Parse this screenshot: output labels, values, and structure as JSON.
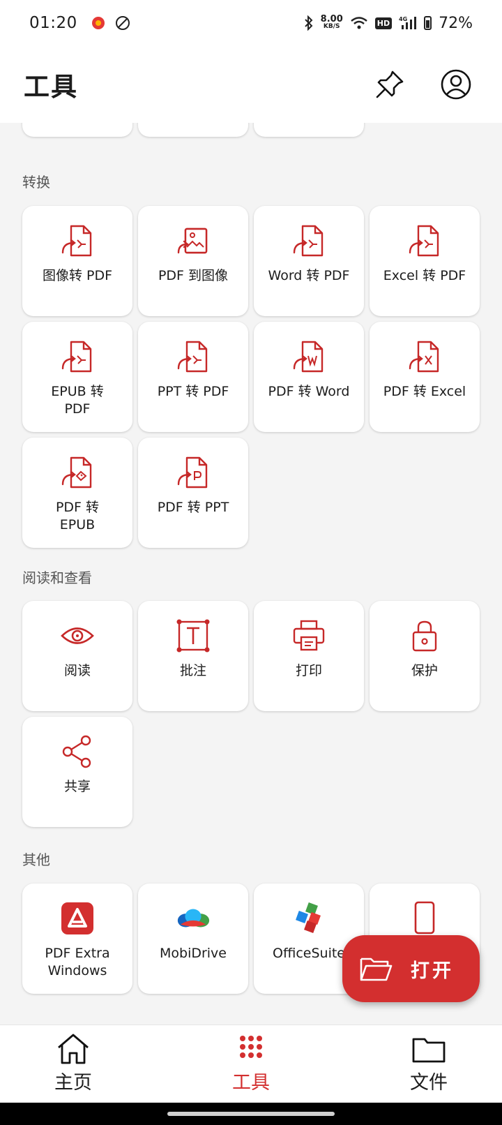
{
  "status_bar": {
    "time": "01:20",
    "net_speed_value": "8.00",
    "net_speed_unit": "KB/S",
    "hd": "HD",
    "signal": "4G",
    "battery": "72%"
  },
  "header": {
    "title": "工具"
  },
  "sections": {
    "convert": {
      "title": "转换",
      "tiles": [
        {
          "label": "图像转 PDF",
          "icon": "image-to-pdf-icon"
        },
        {
          "label": "PDF 到图像",
          "icon": "pdf-to-image-icon"
        },
        {
          "label": "Word 转 PDF",
          "icon": "word-to-pdf-icon"
        },
        {
          "label": "Excel 转 PDF",
          "icon": "excel-to-pdf-icon"
        },
        {
          "label": "EPUB 转\nPDF",
          "icon": "epub-to-pdf-icon"
        },
        {
          "label": "PPT 转 PDF",
          "icon": "ppt-to-pdf-icon"
        },
        {
          "label": "PDF 转 Word",
          "icon": "pdf-to-word-icon"
        },
        {
          "label": "PDF 转 Excel",
          "icon": "pdf-to-excel-icon"
        },
        {
          "label": "PDF 转\nEPUB",
          "icon": "pdf-to-epub-icon"
        },
        {
          "label": "PDF 转 PPT",
          "icon": "pdf-to-ppt-icon"
        }
      ]
    },
    "read": {
      "title": "阅读和查看",
      "tiles": [
        {
          "label": "阅读",
          "icon": "eye-icon"
        },
        {
          "label": "批注",
          "icon": "annotate-icon"
        },
        {
          "label": "打印",
          "icon": "printer-icon"
        },
        {
          "label": "保护",
          "icon": "lock-icon"
        },
        {
          "label": "共享",
          "icon": "share-icon"
        }
      ]
    },
    "other": {
      "title": "其他",
      "tiles": [
        {
          "label": "PDF Extra\nWindows",
          "icon": "pdf-extra-logo-icon"
        },
        {
          "label": "MobiDrive",
          "icon": "mobidrive-logo-icon"
        },
        {
          "label": "OfficeSuite",
          "icon": "officesuite-logo-icon"
        }
      ]
    }
  },
  "fab": {
    "label": "打开"
  },
  "bottom_nav": [
    {
      "label": "主页",
      "icon": "home-icon"
    },
    {
      "label": "工具",
      "icon": "grid-dots-icon"
    },
    {
      "label": "文件",
      "icon": "folder-icon"
    }
  ],
  "colors": {
    "accent": "#d32f2f",
    "background": "#f4f4f4",
    "surface": "#ffffff"
  }
}
